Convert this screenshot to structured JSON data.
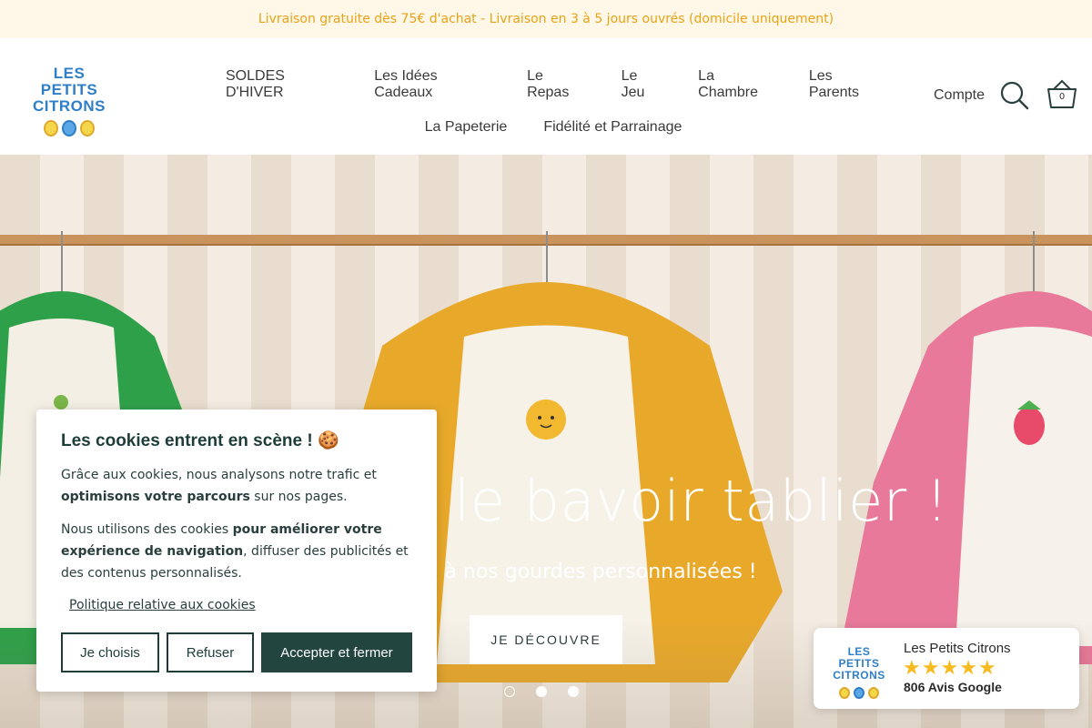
{
  "announcement": {
    "text": "Livraison gratuite dès 75€ d'achat - Livraison en 3 à 5 jours ouvrés (domicile uniquement)"
  },
  "header": {
    "logo_text": "LES PETITS CITRONS",
    "nav": {
      "row1": [
        "SOLDES D'HIVER",
        "Les Idées Cadeaux",
        "Le Repas",
        "Le Jeu",
        "La Chambre",
        "Les Parents"
      ],
      "row2": [
        "La Papeterie",
        "Fidélité et Parrainage"
      ]
    },
    "account_label": "Compte",
    "cart_count": "0"
  },
  "hero": {
    "title": "Maé le bavoir tablier !",
    "subtitle": "à nos gourdes personnalisées !",
    "cta_label": "JE DÉCOUVRE",
    "slides": 3,
    "active_slide": 1
  },
  "cookie_banner": {
    "title": "Les cookies entrent en scène ! 🍪",
    "p1_pre": "Grâce aux cookies, nous analysons notre trafic et ",
    "p1_bold": "optimisons votre parcours",
    "p1_post": " sur nos pages.",
    "p2_pre": "Nous utilisons des cookies ",
    "p2_bold": "pour améliorer votre expérience de navigation",
    "p2_post": ", diffuser des publicités et des contenus personnalisés.",
    "policy_link": "Politique relative aux cookies",
    "buttons": {
      "choose": "Je choisis",
      "refuse": "Refuser",
      "accept": "Accepter et fermer"
    }
  },
  "reviews": {
    "logo_text": "LES PETITS CITRONS",
    "name": "Les Petits Citrons",
    "rating": 5,
    "count_text": "806 Avis Google"
  },
  "colors": {
    "announce_bg": "#fff7e8",
    "announce_text": "#e8a317",
    "logo_blue": "#2f7fc8",
    "cookie_dark": "#22463f",
    "star": "#f6bb20"
  }
}
